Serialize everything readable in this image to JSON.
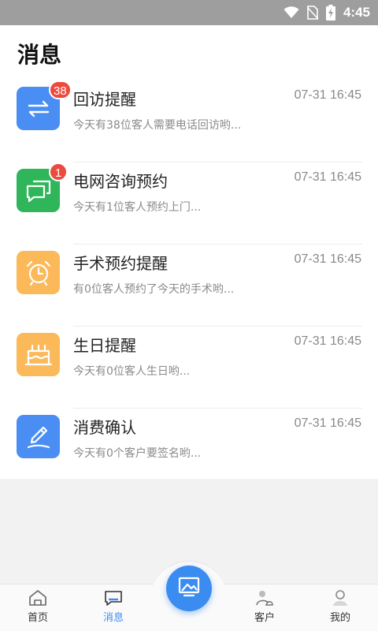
{
  "status_bar": {
    "time": "4:45",
    "icons": [
      "wifi-icon",
      "no-sim-icon",
      "battery-charging-icon"
    ]
  },
  "page": {
    "title": "消息"
  },
  "messages": [
    {
      "title": "回访提醒",
      "time": "07-31 16:45",
      "preview": "今天有38位客人需要电话回访哟...",
      "badge": "38",
      "icon": "swap-arrows-icon",
      "color": "#4a8ef4"
    },
    {
      "title": "电网咨询预约",
      "time": "07-31 16:45",
      "preview": "今天有1位客人预约上门...",
      "badge": "1",
      "icon": "chat-bubbles-icon",
      "color": "#2fb55a"
    },
    {
      "title": "手术预约提醒",
      "time": "07-31 16:45",
      "preview": "有0位客人预约了今天的手术哟...",
      "badge": "",
      "icon": "alarm-clock-icon",
      "color": "#fbb95a"
    },
    {
      "title": "生日提醒",
      "time": "07-31 16:45",
      "preview": "今天有0位客人生日哟...",
      "badge": "",
      "icon": "birthday-cake-icon",
      "color": "#fbb95a"
    },
    {
      "title": "消费确认",
      "time": "07-31 16:45",
      "preview": "今天有0个客户要签名哟...",
      "badge": "",
      "icon": "signature-pen-icon",
      "color": "#4a8ef4"
    }
  ],
  "tab_bar": {
    "tabs": [
      {
        "label": "首页",
        "icon": "home-icon"
      },
      {
        "label": "消息",
        "icon": "message-icon",
        "active": true
      },
      {
        "label": "客户",
        "icon": "customer-icon"
      },
      {
        "label": "我的",
        "icon": "profile-icon"
      }
    ],
    "center_icon": "gallery-icon",
    "accent": "#3a8cf0"
  }
}
